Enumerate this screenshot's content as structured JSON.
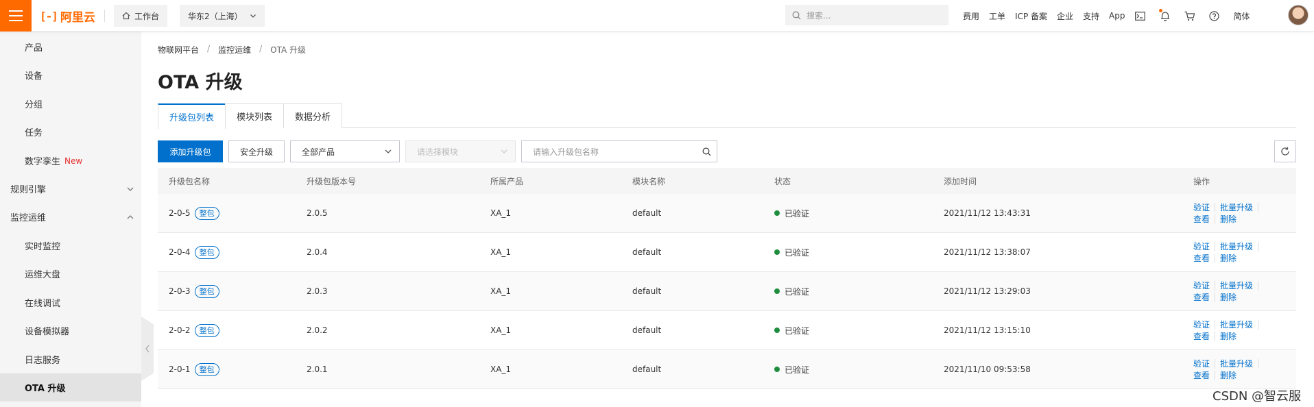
{
  "topbar": {
    "logo_text": "阿里云",
    "workbench": "工作台",
    "region": "华东2（上海）",
    "search_placeholder": "搜索...",
    "links": [
      "费用",
      "工单",
      "ICP 备案",
      "企业",
      "支持",
      "App"
    ],
    "lang": "简体",
    "brand_color": "#ff6a00"
  },
  "sidebar": {
    "items": [
      {
        "label": "产品",
        "kind": "sub"
      },
      {
        "label": "设备",
        "kind": "sub"
      },
      {
        "label": "分组",
        "kind": "sub"
      },
      {
        "label": "任务",
        "kind": "sub"
      },
      {
        "label": "数字孪生",
        "kind": "sub",
        "tag": "New"
      },
      {
        "label": "规则引擎",
        "kind": "group",
        "expanded": false
      },
      {
        "label": "监控运维",
        "kind": "group",
        "expanded": true
      },
      {
        "label": "实时监控",
        "kind": "sub"
      },
      {
        "label": "运维大盘",
        "kind": "sub"
      },
      {
        "label": "在线调试",
        "kind": "sub"
      },
      {
        "label": "设备模拟器",
        "kind": "sub"
      },
      {
        "label": "日志服务",
        "kind": "sub"
      },
      {
        "label": "OTA 升级",
        "kind": "sub",
        "active": true
      }
    ]
  },
  "breadcrumb": [
    "物联网平台",
    "监控运维",
    "OTA 升级"
  ],
  "page_title": "OTA 升级",
  "tabs": [
    {
      "label": "升级包列表",
      "active": true
    },
    {
      "label": "模块列表"
    },
    {
      "label": "数据分析"
    }
  ],
  "toolbar": {
    "add_button": "添加升级包",
    "secure_button": "安全升级",
    "product_select": "全部产品",
    "module_select_placeholder": "请选择模块",
    "search_placeholder": "请输入升级包名称",
    "accent_color": "#0070cc"
  },
  "table": {
    "columns": [
      "升级包名称",
      "升级包版本号",
      "所属产品",
      "模块名称",
      "状态",
      "添加时间",
      "操作"
    ],
    "rows": [
      {
        "name": "2-0-5",
        "tag": "整包",
        "version": "2.0.5",
        "product": "XA_1",
        "module": "default",
        "status": "已验证",
        "time": "2021/11/12 13:43:31"
      },
      {
        "name": "2-0-4",
        "tag": "整包",
        "version": "2.0.4",
        "product": "XA_1",
        "module": "default",
        "status": "已验证",
        "time": "2021/11/12 13:38:07"
      },
      {
        "name": "2-0-3",
        "tag": "整包",
        "version": "2.0.3",
        "product": "XA_1",
        "module": "default",
        "status": "已验证",
        "time": "2021/11/12 13:29:03"
      },
      {
        "name": "2-0-2",
        "tag": "整包",
        "version": "2.0.2",
        "product": "XA_1",
        "module": "default",
        "status": "已验证",
        "time": "2021/11/12 13:15:10"
      },
      {
        "name": "2-0-1",
        "tag": "整包",
        "version": "2.0.1",
        "product": "XA_1",
        "module": "default",
        "status": "已验证",
        "time": "2021/11/10 09:53:58"
      }
    ],
    "actions": [
      "验证",
      "批量升级",
      "查看",
      "删除"
    ],
    "status_color": "#1e8e3e"
  },
  "watermark": "CSDN @智云服"
}
